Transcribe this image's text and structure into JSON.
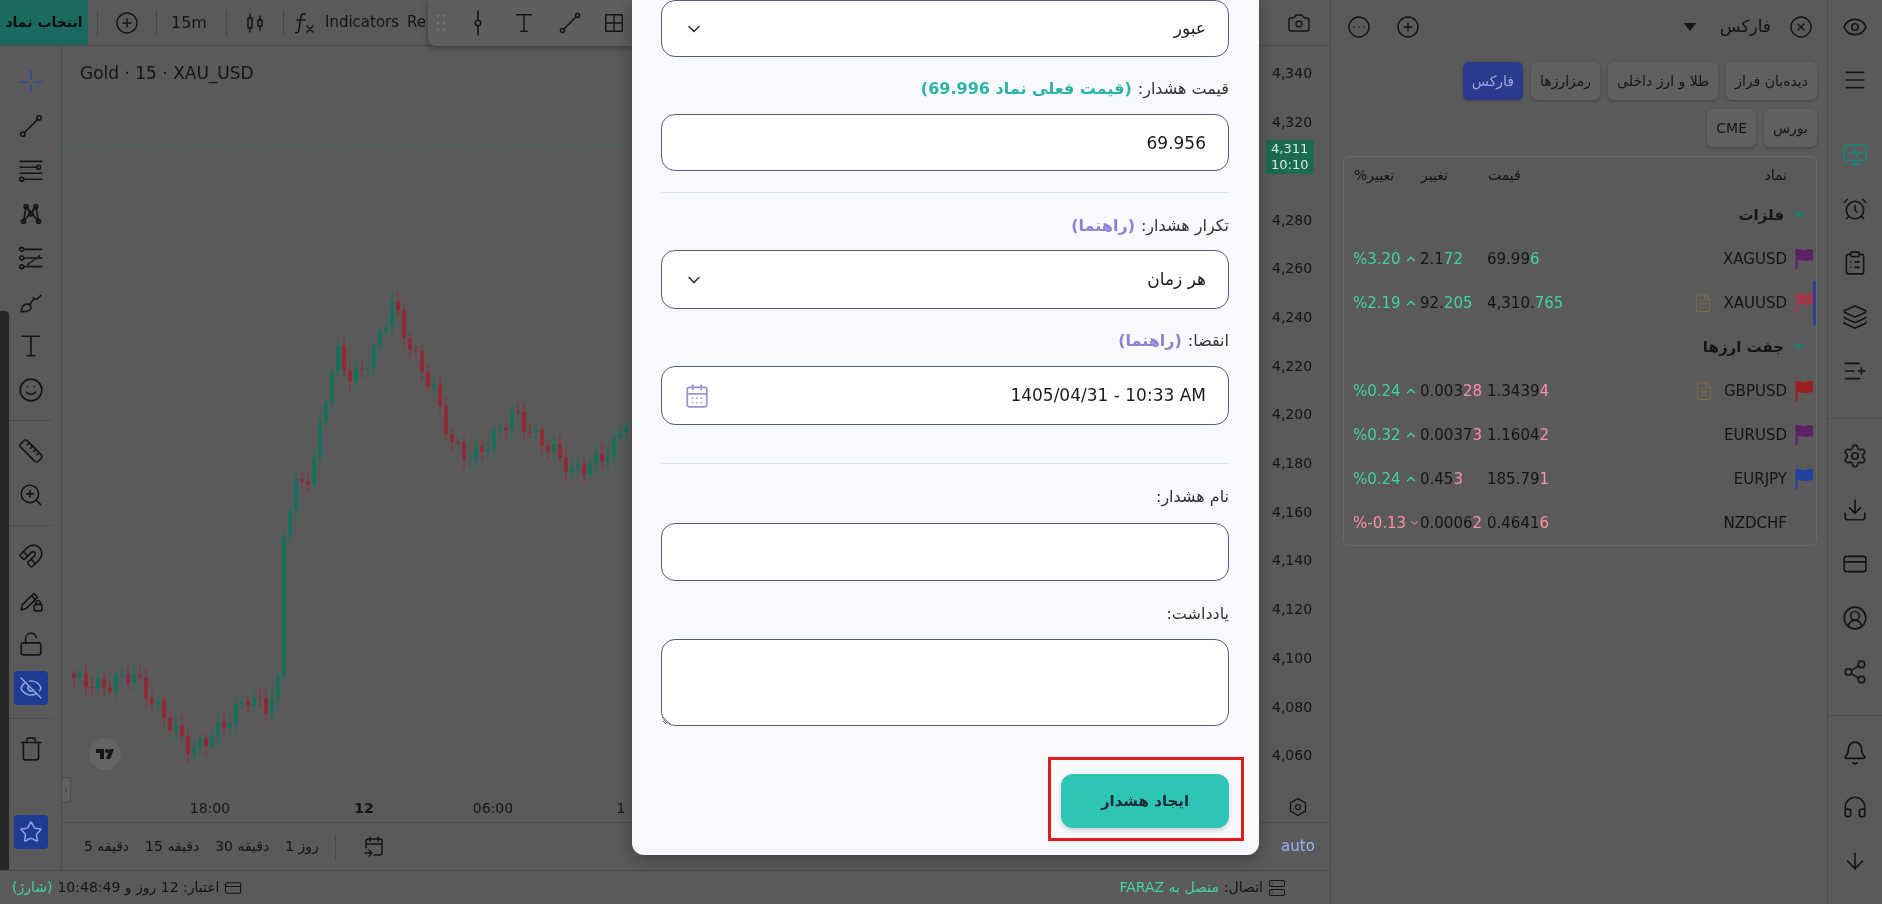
{
  "toolbar": {
    "symbol_button": "انتخاب نماد",
    "interval": "15m",
    "indicators": "Indicators",
    "cut_item": "Re"
  },
  "left_toolbar": {
    "groups": [
      {
        "tools": [
          {
            "kind": "crosshair",
            "selected": true,
            "on": false
          },
          {
            "kind": "trend-line",
            "selected": false,
            "on": false
          },
          {
            "kind": "parallel-lines",
            "selected": false,
            "on": false
          },
          {
            "kind": "pattern",
            "selected": false,
            "on": false
          },
          {
            "kind": "fib",
            "selected": false,
            "on": false
          },
          {
            "kind": "brush",
            "selected": false,
            "on": false
          },
          {
            "kind": "text",
            "selected": false,
            "on": false
          },
          {
            "kind": "emoji",
            "selected": false,
            "on": false
          }
        ]
      },
      {
        "tools": [
          {
            "kind": "ruler",
            "selected": false,
            "on": false
          },
          {
            "kind": "zoom",
            "selected": false,
            "on": false
          }
        ]
      },
      {
        "tools": [
          {
            "kind": "magnet",
            "selected": false,
            "on": false
          },
          {
            "kind": "lock-drawings",
            "selected": false,
            "on": false
          },
          {
            "kind": "unlock",
            "selected": false,
            "on": false
          },
          {
            "kind": "hide-indicators",
            "selected": false,
            "on": true
          }
        ]
      },
      {
        "tools": [
          {
            "kind": "trash",
            "selected": false,
            "on": false
          }
        ]
      }
    ],
    "bottom": [
      {
        "kind": "favorites",
        "selected": false,
        "on": true
      }
    ]
  },
  "chart": {
    "title": "Gold · 15 · XAU_USD",
    "price_axis": [
      {
        "kind": "tick",
        "label": "4,340"
      },
      {
        "kind": "tick",
        "label": "4,320"
      },
      {
        "kind": "current",
        "price": "4,311",
        "time": "10:10"
      },
      {
        "kind": "tick",
        "label": "4,280"
      },
      {
        "kind": "tick",
        "label": "4,260"
      },
      {
        "kind": "tick",
        "label": "4,240"
      },
      {
        "kind": "tick",
        "label": "4,220"
      },
      {
        "kind": "tick",
        "label": "4,200"
      },
      {
        "kind": "tick",
        "label": "4,180"
      },
      {
        "kind": "tick",
        "label": "4,160"
      },
      {
        "kind": "tick",
        "label": "4,140"
      },
      {
        "kind": "tick",
        "label": "4,120"
      },
      {
        "kind": "tick",
        "label": "4,100"
      },
      {
        "kind": "tick",
        "label": "4,080"
      },
      {
        "kind": "tick",
        "label": "4,060"
      }
    ],
    "time_axis": [
      {
        "label": "1",
        "bold": false
      },
      {
        "label": "06:00",
        "bold": false
      },
      {
        "label": "12",
        "bold": true
      },
      {
        "label": "18:00",
        "bold": false
      }
    ],
    "scale_mode": "auto"
  },
  "timeframes": [
    "1 روز",
    "30 دقیقه",
    "15 دقیقه",
    "5 دقیقه"
  ],
  "status_bar": {
    "credit": "اعتبار: 12 روز و 10:48:49",
    "recharge": "(شارژ)",
    "connection_label": "اتصال:",
    "connection_value": "متصل به FARAZ"
  },
  "alert_dialog": {
    "condition": "عبور",
    "price_label": "قیمت هشدار:",
    "price_hint": "(قیمت فعلی نماد 69.996)",
    "price_value": "69.956",
    "repeat_label": "تکرار هشدار:",
    "repeat_help": "(راهنما)",
    "repeat_value": "هر زمان",
    "expiry_label": "انقضا:",
    "expiry_help": "(راهنما)",
    "expiry_value": "1405/04/31 - 10:33 AM",
    "name_label": "نام هشدار:",
    "note_label": "یادداشت:",
    "submit": {
      "label": "ایجاد هشدار",
      "highlighted": true
    }
  },
  "watchlist": {
    "title": "فارکس",
    "tabs": [
      {
        "label": "دیده‌بان فراز",
        "selected": false
      },
      {
        "label": "طلا و ارز داخلی",
        "selected": false
      },
      {
        "label": "رمزارزها",
        "selected": false
      },
      {
        "label": "فارکس",
        "selected": true
      },
      {
        "label": "بورس",
        "selected": false
      },
      {
        "label": "CME",
        "selected": false
      }
    ],
    "columns": [
      "نماد",
      "قیمت",
      "تغییر",
      "تغییر%"
    ],
    "groups": [
      {
        "name": "فلزات",
        "expanded": true,
        "rows": [
          {
            "symbol": "XAGUSD",
            "color": "#5c2168",
            "has_note": false,
            "selected": false,
            "price": {
              "base": "69.99",
              "tail": "6"
            },
            "change": {
              "base": "2.1",
              "tail": "72"
            },
            "tick_up": true,
            "percent": "%3.20",
            "trend_up": true
          },
          {
            "symbol": "XAUUSD",
            "color": "#9c3a4c",
            "has_note": true,
            "selected": true,
            "price": {
              "base": "4,310.",
              "tail": "765"
            },
            "change": {
              "base": "92.",
              "tail": "205"
            },
            "tick_up": true,
            "percent": "%2.19",
            "trend_up": true
          }
        ]
      },
      {
        "name": "جفت ارزها",
        "expanded": true,
        "rows": [
          {
            "symbol": "GBPUSD",
            "color": "#9a1f1f",
            "has_note": true,
            "selected": false,
            "price": {
              "base": "1.3439",
              "tail": "4"
            },
            "change": {
              "base": "0.003",
              "tail": "28"
            },
            "tick_up": false,
            "percent": "%0.24",
            "trend_up": true
          },
          {
            "symbol": "EURUSD",
            "color": "#5c2168",
            "has_note": false,
            "selected": false,
            "price": {
              "base": "1.1604",
              "tail": "2"
            },
            "change": {
              "base": "0.0037",
              "tail": "3"
            },
            "tick_up": false,
            "percent": "%0.32",
            "trend_up": true
          },
          {
            "symbol": "EURJPY",
            "color": "#1f449e",
            "has_note": false,
            "selected": false,
            "price": {
              "base": "185.79",
              "tail": "1"
            },
            "change": {
              "base": "0.45",
              "tail": "3"
            },
            "tick_up": false,
            "percent": "%0.24",
            "trend_up": true
          },
          {
            "symbol": "NZDCHF",
            "has_note": false,
            "selected": false,
            "price": {
              "base": "0.4641",
              "tail": "6"
            },
            "change": {
              "base": "0.0006",
              "tail": "2"
            },
            "tick_up": false,
            "percent": "%-0.13",
            "trend_up": false
          }
        ]
      }
    ]
  },
  "side_icons": {
    "top": [
      {
        "kind": "eye",
        "selected": false
      },
      {
        "kind": "menu",
        "selected": false
      }
    ],
    "sections": [
      {
        "items": [
          {
            "kind": "monitor",
            "selected": true
          },
          {
            "kind": "alarm",
            "selected": false
          },
          {
            "kind": "clipboard",
            "selected": false
          },
          {
            "kind": "layers",
            "selected": false
          },
          {
            "kind": "list-plus",
            "selected": false
          }
        ]
      },
      {
        "items": [
          {
            "kind": "settings",
            "selected": false
          },
          {
            "kind": "download",
            "selected": false
          },
          {
            "kind": "card",
            "selected": false
          },
          {
            "kind": "user",
            "selected": false
          },
          {
            "kind": "share",
            "selected": false
          }
        ]
      },
      {
        "items": [
          {
            "kind": "bell",
            "selected": false
          },
          {
            "kind": "headphones",
            "selected": false
          },
          {
            "kind": "arrow-down",
            "selected": false
          }
        ]
      }
    ]
  }
}
